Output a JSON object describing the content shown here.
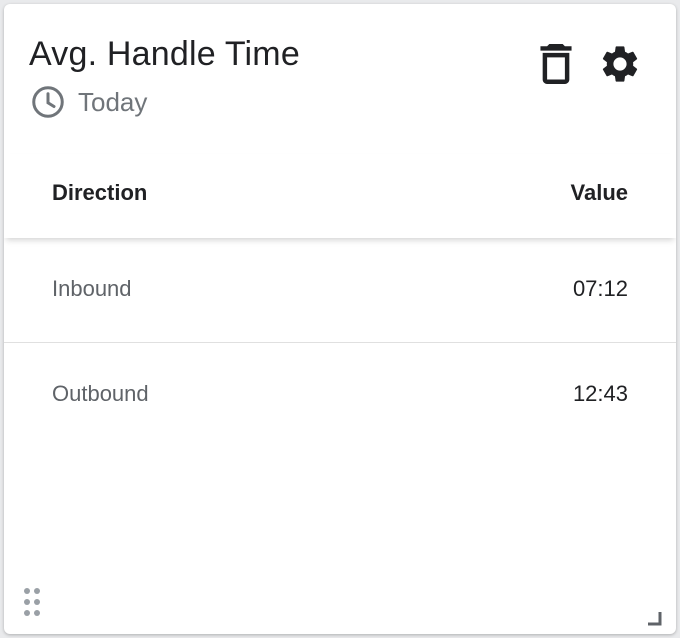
{
  "widget": {
    "title": "Avg. Handle Time",
    "time_range": "Today",
    "icons": {
      "time_range": "clock-icon",
      "delete": "trash-icon",
      "settings": "gear-icon",
      "drag": "drag-handle-icon",
      "resize": "resize-corner-icon"
    }
  },
  "table": {
    "columns": [
      "Direction",
      "Value"
    ],
    "rows": [
      {
        "direction": "Inbound",
        "value": "07:12"
      },
      {
        "direction": "Outbound",
        "value": "12:43"
      }
    ]
  },
  "colors": {
    "text_primary": "#202124",
    "text_secondary": "#5f6368",
    "icon": "#202124",
    "divider": "#e0e0e0"
  }
}
